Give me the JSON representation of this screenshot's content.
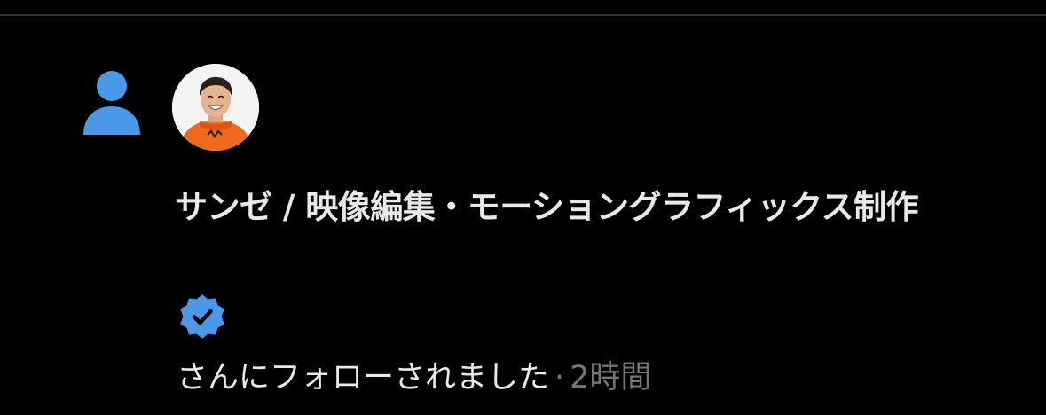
{
  "colors": {
    "background": "#000000",
    "divider": "#2f3336",
    "accent": "#4a99e9",
    "text_primary": "#e7e9ea",
    "text_secondary": "#71767b"
  },
  "notification": {
    "type_icon": "person-icon",
    "user_name": "サンゼ / 映像編集・モーショングラフィックス制作",
    "verified": true,
    "verified_icon": "verified-badge-icon",
    "message": "さんにフォローされました",
    "separator": "·",
    "timestamp": "2時間"
  }
}
